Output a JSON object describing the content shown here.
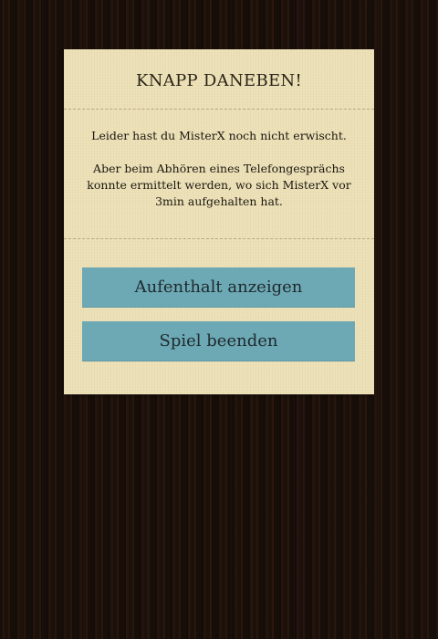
{
  "dialog": {
    "title": "KNAPP DANEBEN!",
    "message_line1": "Leider hast du MisterX noch nicht erwischt.",
    "message_line2": "Aber beim Abhören eines Telefongesprächs konnte ermittelt werden, wo sich MisterX vor 3min aufgehalten hat.",
    "buttons": {
      "show_location": "Aufenthalt anzeigen",
      "end_game": "Spiel beenden"
    }
  },
  "colors": {
    "background": "#1f120c",
    "dialog": "#ece0b6",
    "button": "#6da8b5",
    "text": "#1c1810"
  }
}
